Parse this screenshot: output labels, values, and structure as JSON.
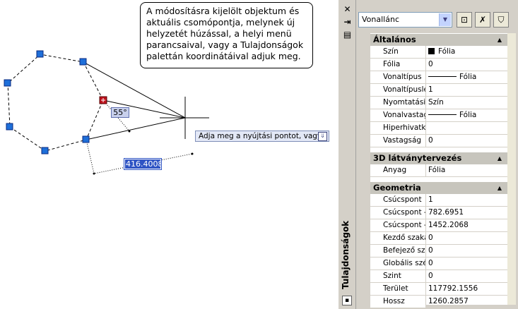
{
  "callout": {
    "line1": "A módosításra kijelölt objektum és",
    "line2": "aktuális csomópontja, melynek új",
    "line3": "helyzetét húzással, a helyi menü",
    "line4": "parancsaival, vagy a Tulajdonságok",
    "line5": "palettán koordinátáival adjuk meg."
  },
  "canvas": {
    "prompt_text": "Adja meg a nyújtási pontot, vagy",
    "prompt_button": "⇓",
    "angle_label": "55°",
    "distance_value": "416.4008"
  },
  "palette": {
    "title": "Tulajdonságok",
    "close_glyph": "✕",
    "autohide_glyph": "⇥",
    "properties_glyph": "▤",
    "object_type": "Vonallánc",
    "toolbar_icons": [
      "quick-select-icon",
      "select-objects-icon",
      "toggle-pickadd-icon"
    ],
    "colors": {
      "accent": "#2f54c4",
      "panel": "#d4d0c8",
      "category": "#c7c5bd"
    },
    "categories": [
      {
        "title": "Általános",
        "rows": [
          {
            "name": "Szín",
            "value": "Fólia"
          },
          {
            "name": "Fólia",
            "value": "0"
          },
          {
            "name": "Vonaltípus",
            "value": "Fólia"
          },
          {
            "name": "Vonaltípuslé...",
            "value": "1"
          },
          {
            "name": "Nyomtatási ...",
            "value": "Szín"
          },
          {
            "name": "Vonalvastag...",
            "value": "Fólia"
          },
          {
            "name": "Hiperhivatko...",
            "value": ""
          },
          {
            "name": "Vastagság",
            "value": "0"
          }
        ]
      },
      {
        "title": "3D látványtervezés",
        "rows": [
          {
            "name": "Anyag",
            "value": "Fólia"
          }
        ]
      },
      {
        "title": "Geometria",
        "rows": [
          {
            "name": "Csúcspont",
            "value": "1"
          },
          {
            "name": "Csúcspont - X",
            "value": "782.6951"
          },
          {
            "name": "Csúcspont - Y",
            "value": "1452.2068"
          },
          {
            "name": "Kezdő szaka...",
            "value": "0"
          },
          {
            "name": "Befejező sza...",
            "value": "0"
          },
          {
            "name": "Globális szél...",
            "value": "0"
          },
          {
            "name": "Szint",
            "value": "0"
          },
          {
            "name": "Terület",
            "value": "117792.1556"
          },
          {
            "name": "Hossz",
            "value": "1260.2857"
          }
        ]
      }
    ]
  }
}
